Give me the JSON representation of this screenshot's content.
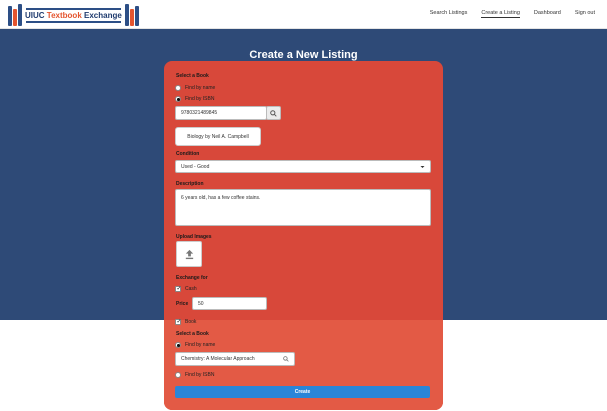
{
  "logo": {
    "part1": "UIUC",
    "part2": "Textbook",
    "part3": "Exchange"
  },
  "nav": {
    "search": "Search Listings",
    "create": "Create a Listing",
    "dashboard": "Dashboard",
    "signout": "Sign out"
  },
  "page_title": "Create a New Listing",
  "form": {
    "select_book_label": "Select a Book",
    "find_by_name": "Find by name",
    "find_by_isbn": "Find by ISBN",
    "isbn_value": "9780321489845",
    "book_result": "Biology by Neil A. Campbell",
    "condition_label": "Condition",
    "condition_value": "Used - Good",
    "description_label": "Description",
    "description_value": "6 years old, has a few coffee stains.",
    "upload_label": "Upload Images",
    "exchange_label": "Exchange for",
    "cash_label": "Cash",
    "price_label": "Price",
    "price_value": "50",
    "book_label": "Book",
    "select_book_label_2": "Select a Book",
    "find_by_name_2": "Find by name",
    "name_search_value": "Chemistry: A Molecular Approach",
    "find_by_isbn_2": "Find by ISBN",
    "create_label": "Create"
  },
  "colors": {
    "hero": "#2e4a77",
    "card": "#d8483a",
    "card_low": "#e35a45",
    "button": "#2a85d8"
  },
  "icons": [
    "search-icon",
    "chevron-down-icon",
    "upload-icon",
    "check-icon"
  ]
}
